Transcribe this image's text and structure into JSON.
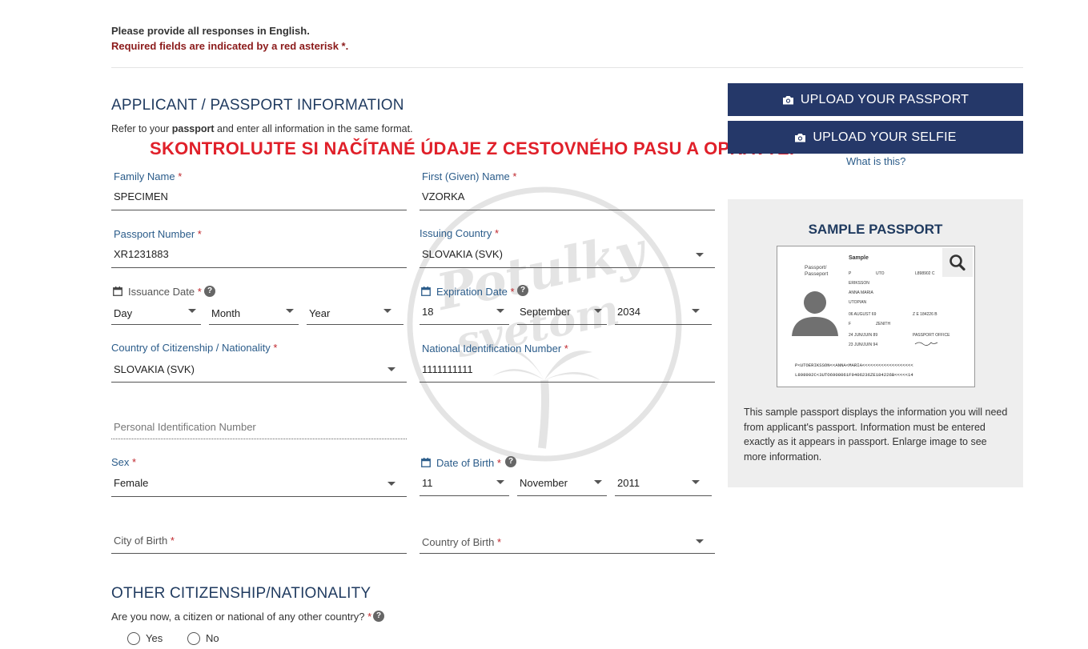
{
  "notes": {
    "english": "Please provide all responses in English.",
    "required": "Required fields are indicated by a red asterisk *."
  },
  "applicant": {
    "title": "APPLICANT / PASSPORT INFORMATION",
    "subtext_pre": "Refer to your ",
    "subtext_bold": "passport",
    "subtext_post": " and enter all information in the same format."
  },
  "overlay_text": "SKONTROLUJTE SI NAČÍTANÉ ÚDAJE Z CESTOVNÉHO PASU A OPRAVTE.",
  "required_mark": "*",
  "help_glyph": "?",
  "fields": {
    "family_name": {
      "label": "Family Name",
      "value": "SPECIMEN"
    },
    "first_name": {
      "label": "First (Given) Name",
      "value": "VZORKA"
    },
    "passport_number": {
      "label": "Passport Number",
      "value": "XR1231883"
    },
    "issuing_country": {
      "label": "Issuing Country",
      "value": "SLOVAKIA (SVK)"
    },
    "issuance_date": {
      "label": "Issuance Date",
      "day": "Day",
      "month": "Month",
      "year": "Year"
    },
    "expiration_date": {
      "label": "Expiration Date",
      "day": "18",
      "month": "September",
      "year": "2034"
    },
    "citizenship": {
      "label": "Country of Citizenship / Nationality",
      "value": "SLOVAKIA (SVK)"
    },
    "national_id": {
      "label": "National Identification Number",
      "value": "1111111111"
    },
    "personal_id": {
      "placeholder": "Personal Identification Number"
    },
    "sex": {
      "label": "Sex",
      "value": "Female"
    },
    "dob": {
      "label": "Date of Birth",
      "day": "11",
      "month": "November",
      "year": "2011"
    },
    "city_of_birth": {
      "label": "City of Birth"
    },
    "country_of_birth": {
      "label": "Country of Birth"
    }
  },
  "buttons": {
    "upload_passport": "UPLOAD YOUR PASSPORT",
    "upload_selfie": "UPLOAD YOUR SELFIE",
    "what_is_this": "What is this?"
  },
  "sample": {
    "title": "SAMPLE PASSPORT",
    "passport_label": "Passport/ Passeport",
    "sample_word": "Sample",
    "card_type": "P",
    "card_code": "UTO",
    "card_number": "L898902 C",
    "surname": "ERIKSSON",
    "given": "ANNA MARIA",
    "nationality": "UTOPIAN",
    "dob": "06 AUGUST 69",
    "personal_no": "Z E 184226 B",
    "sex": "F",
    "place": "ZENITH",
    "issue": "24 JUN/JUIN 89",
    "authority": "PASSPORT OFFICE",
    "expiry": "23 JUN/JUIN 94",
    "mrz1": "P<UTOERIKSSON<<ANNA<MARIA<<<<<<<<<<<<<<<<<<<",
    "mrz2": "L898902C<3UTO6908061F9406236ZE184226B<<<<<14",
    "description": "This sample passport displays the information you will need from applicant's passport. Information must be entered exactly as it appears in passport. Enlarge image to see more information."
  },
  "other": {
    "title": "OTHER CITIZENSHIP/NATIONALITY",
    "question": "Are you now, a citizen or national of any other country?",
    "yes": "Yes",
    "no": "No"
  },
  "watermark": {
    "line1": "Potulky",
    "line2": "svetom"
  }
}
